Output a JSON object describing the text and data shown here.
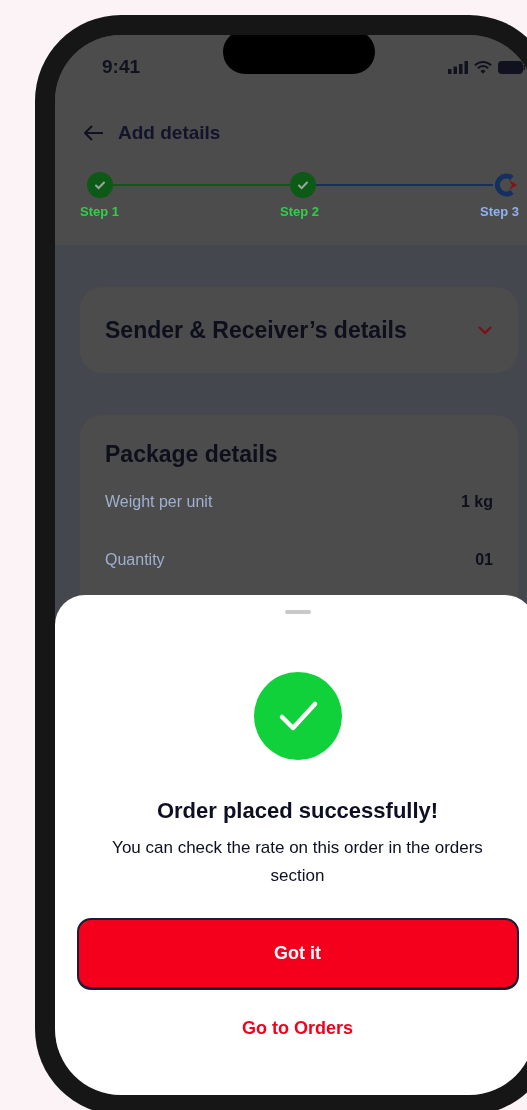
{
  "status_bar": {
    "time": "9:41"
  },
  "header": {
    "title": "Add details"
  },
  "stepper": {
    "steps": [
      {
        "label": "Step 1",
        "completed": true
      },
      {
        "label": "Step 2",
        "completed": true
      },
      {
        "label": "Step 3",
        "completed": false
      }
    ]
  },
  "sender_card": {
    "title": "Sender & Receiver’s details",
    "expanded": false
  },
  "package_card": {
    "title": "Package details",
    "rows": [
      {
        "label": "Weight per unit",
        "value": "1 kg"
      },
      {
        "label": "Quantity",
        "value": "01"
      }
    ]
  },
  "sheet": {
    "title": "Order placed successfully!",
    "message": "You can check the rate on this order in the orders section",
    "primary_button": "Got it",
    "link_button": "Go to Orders"
  }
}
